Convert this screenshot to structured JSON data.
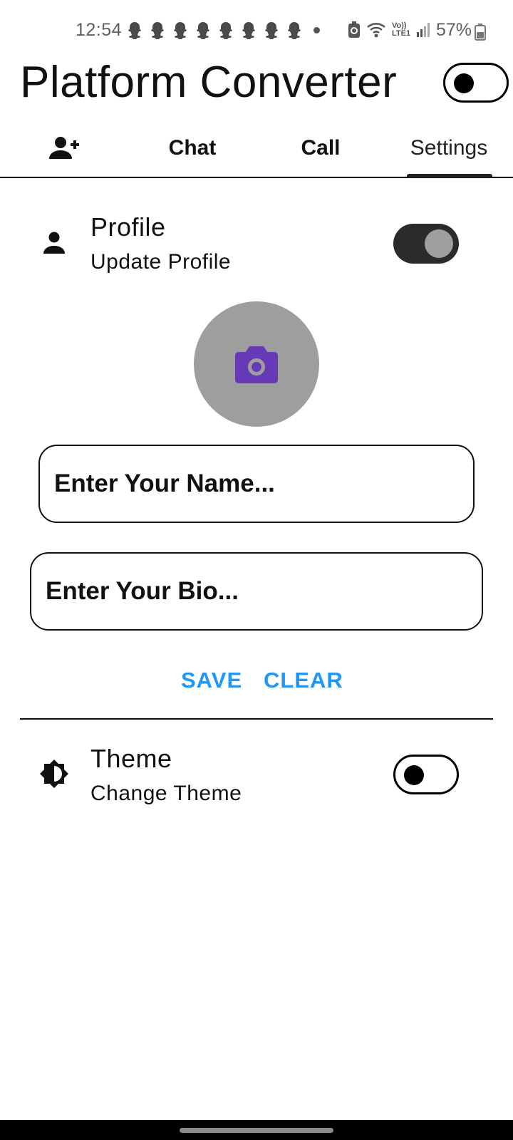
{
  "status_bar": {
    "time": "12:54",
    "battery_percent": "57%",
    "network_label_top": "Vo))",
    "network_label_bottom": "LTE1",
    "notification_icons": [
      "snapchat-icon",
      "snapchat-icon",
      "snapchat-icon",
      "snapchat-icon",
      "snapchat-icon",
      "snapchat-icon",
      "snapchat-icon",
      "snapchat-icon"
    ]
  },
  "app_bar": {
    "title": "Platform Converter",
    "platform_toggle_on": false
  },
  "tabs": {
    "items": [
      {
        "icon": "person-add-icon",
        "label": ""
      },
      {
        "label": "Chat"
      },
      {
        "label": "Call"
      },
      {
        "label": "Settings"
      }
    ],
    "active_index": 3
  },
  "profile": {
    "title": "Profile",
    "subtitle": "Update Profile",
    "toggle_on": true,
    "name_field": {
      "value": "",
      "placeholder": "Enter Your Name..."
    },
    "bio_field": {
      "value": "",
      "placeholder": "Enter Your Bio..."
    },
    "save_label": "SAVE",
    "clear_label": "CLEAR"
  },
  "theme": {
    "title": "Theme",
    "subtitle": "Change Theme",
    "toggle_on": false
  },
  "colors": {
    "accent_button": "#2196f3",
    "camera_icon": "#673ab7",
    "avatar_bg": "#9e9e9e",
    "toggle_on_track": "#2b2b2b"
  }
}
